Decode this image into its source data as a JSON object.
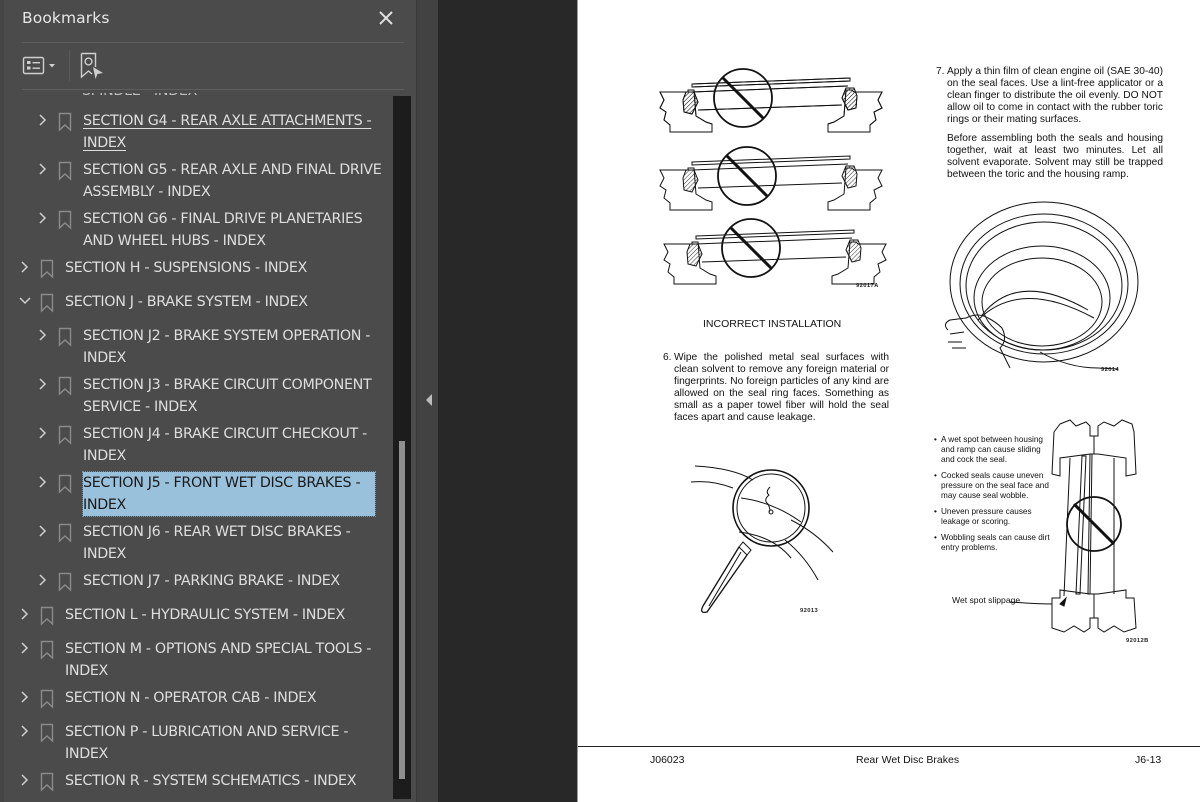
{
  "panel": {
    "title": "Bookmarks",
    "close_icon": "close-icon",
    "toolbar": {
      "options_icon": "options-list-icon",
      "find_icon": "find-current-bookmark-icon"
    },
    "partial_top_item": "SPINDLE - INDEX",
    "items": [
      {
        "label_lines": [
          "SECTION G4 - REAR AXLE ATTACHMENTS -",
          "INDEX"
        ],
        "level": 2,
        "expanded": false,
        "state": "hover"
      },
      {
        "label_lines": [
          "SECTION G5 - REAR AXLE AND FINAL DRIVE",
          "ASSEMBLY - INDEX"
        ],
        "level": 2,
        "expanded": false,
        "state": "normal"
      },
      {
        "label_lines": [
          "SECTION G6 - FINAL DRIVE PLANETARIES",
          "AND WHEEL HUBS - INDEX"
        ],
        "level": 2,
        "expanded": false,
        "state": "normal"
      },
      {
        "label_lines": [
          "SECTION H - SUSPENSIONS - INDEX"
        ],
        "level": 1,
        "expanded": false,
        "state": "normal"
      },
      {
        "label_lines": [
          "SECTION J - BRAKE SYSTEM - INDEX"
        ],
        "level": 1,
        "expanded": true,
        "state": "normal"
      },
      {
        "label_lines": [
          "SECTION J2 - BRAKE SYSTEM OPERATION -",
          "INDEX"
        ],
        "level": 2,
        "expanded": false,
        "state": "normal"
      },
      {
        "label_lines": [
          "SECTION J3 - BRAKE CIRCUIT COMPONENT",
          "SERVICE - INDEX"
        ],
        "level": 2,
        "expanded": false,
        "state": "normal"
      },
      {
        "label_lines": [
          "SECTION J4 - BRAKE CIRCUIT CHECKOUT -",
          "INDEX"
        ],
        "level": 2,
        "expanded": false,
        "state": "normal"
      },
      {
        "label_lines": [
          "SECTION J5 - FRONT WET DISC BRAKES -",
          "INDEX"
        ],
        "level": 2,
        "expanded": false,
        "state": "selected"
      },
      {
        "label_lines": [
          "SECTION J6 - REAR WET DISC BRAKES -",
          "INDEX"
        ],
        "level": 2,
        "expanded": false,
        "state": "normal"
      },
      {
        "label_lines": [
          "SECTION J7 - PARKING BRAKE - INDEX"
        ],
        "level": 2,
        "expanded": false,
        "state": "normal"
      },
      {
        "label_lines": [
          "SECTION L - HYDRAULIC SYSTEM -  INDEX"
        ],
        "level": 1,
        "expanded": false,
        "state": "normal"
      },
      {
        "label_lines": [
          "SECTION M - OPTIONS AND SPECIAL TOOLS -",
          "INDEX"
        ],
        "level": 1,
        "expanded": false,
        "state": "normal"
      },
      {
        "label_lines": [
          "SECTION N - OPERATOR CAB - INDEX"
        ],
        "level": 1,
        "expanded": false,
        "state": "normal"
      },
      {
        "label_lines": [
          "SECTION P - LUBRICATION AND SERVICE -",
          "INDEX"
        ],
        "level": 1,
        "expanded": false,
        "state": "normal"
      },
      {
        "label_lines": [
          "SECTION R - SYSTEM SCHEMATICS - INDEX"
        ],
        "level": 1,
        "expanded": false,
        "state": "normal"
      }
    ]
  },
  "colors": {
    "panel_bg": "#4b4b4b",
    "viewer_bg": "#282828",
    "selection": "#99c1dc",
    "text": "#dedede"
  },
  "document": {
    "step7": {
      "number": "7.",
      "text": "Apply a thin film of clean engine oil (SAE 30-40) on the seal faces. Use a lint-free applicator or a clean finger to distribute the oil evenly. DO NOT allow oil to come in contact with the rubber toric rings or their mating surfaces."
    },
    "step7_note": "Before assembling both the seals and housing together, wait at least two minutes. Let all solvent evaporate. Solvent may still be trapped between the toric and the housing ramp.",
    "step6": {
      "number": "6.",
      "text": "Wipe the polished metal seal surfaces with clean solvent to remove any foreign material or fingerprints. No foreign particles of any kind are allowed on the seal ring faces. Something as small as a paper towel fiber will hold the seal faces apart and cause leakage."
    },
    "figure_caption": "INCORRECT INSTALLATION",
    "figure_ids": {
      "incorrect_installation": "92017A",
      "seal_ring": "92014",
      "magnifier": "92013",
      "wet_spot": "92012B"
    },
    "wet_spot_bullets": [
      "A wet spot between housing and ramp can cause sliding and cock the seal.",
      "Cocked seals cause uneven pressure on the seal face and may cause seal wobble.",
      "Uneven pressure causes leakage or scoring.",
      "Wobbling seals can cause dirt entry problems."
    ],
    "wet_spot_label": "Wet spot slippage",
    "footer": {
      "left": "J06023",
      "center": "Rear Wet Disc Brakes",
      "right": "J6-13"
    }
  }
}
